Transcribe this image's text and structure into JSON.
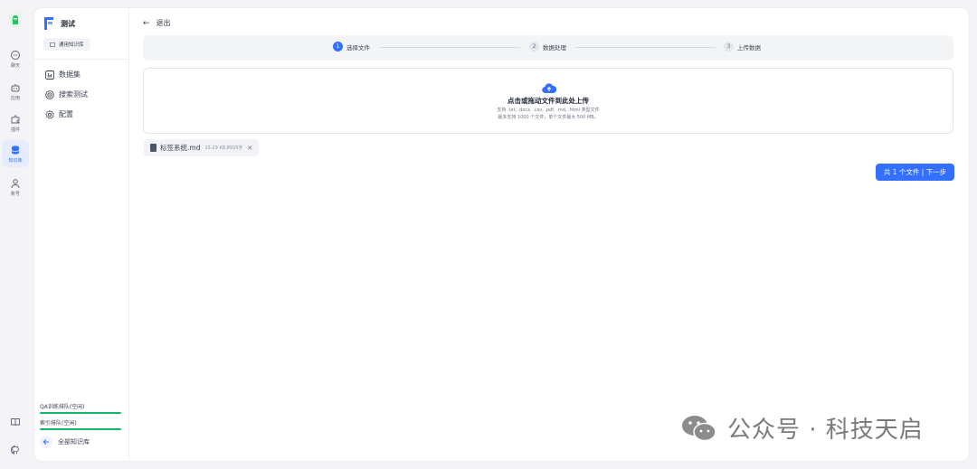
{
  "rail": {
    "items": [
      {
        "label": "聊天",
        "icon": "chat-icon"
      },
      {
        "label": "应用",
        "icon": "robot-icon"
      },
      {
        "label": "插件",
        "icon": "puzzle-icon"
      },
      {
        "label": "知识库",
        "icon": "database-icon"
      },
      {
        "label": "账号",
        "icon": "user-icon"
      }
    ],
    "bottom_icons": [
      "book-icon",
      "github-icon"
    ]
  },
  "sidebar": {
    "kb_title": "测试",
    "kb_type": "通用知识库",
    "nav": [
      {
        "label": "数据集",
        "icon": "table-icon"
      },
      {
        "label": "搜索测试",
        "icon": "target-icon"
      },
      {
        "label": "配置",
        "icon": "gear-icon"
      }
    ],
    "queues": [
      {
        "label": "QA训练排队(空闲)"
      },
      {
        "label": "索引排队(空闲)"
      }
    ],
    "all_kb_label": "全部知识库"
  },
  "main": {
    "back_label": "退出",
    "steps": [
      {
        "num": "1",
        "label": "选择文件",
        "active": true
      },
      {
        "num": "2",
        "label": "数据处理",
        "active": false
      },
      {
        "num": "3",
        "label": "上传数据",
        "active": false
      }
    ],
    "upload": {
      "title": "点击或拖动文件到此处上传",
      "support": "支持 .txt, .docx, .csv, .pdf, .md, .html 类型文件",
      "limit": "最多支持 1000 个文件，单个文件最大 500 MB。"
    },
    "file": {
      "name": "标签系统.md",
      "meta": "15.29 KB,8925字"
    },
    "next_button": "共 1 个文件 | 下一步"
  },
  "watermark": "公众号 · 科技天启",
  "colors": {
    "accent": "#3370ff",
    "queue_bar": "#12b76a"
  }
}
